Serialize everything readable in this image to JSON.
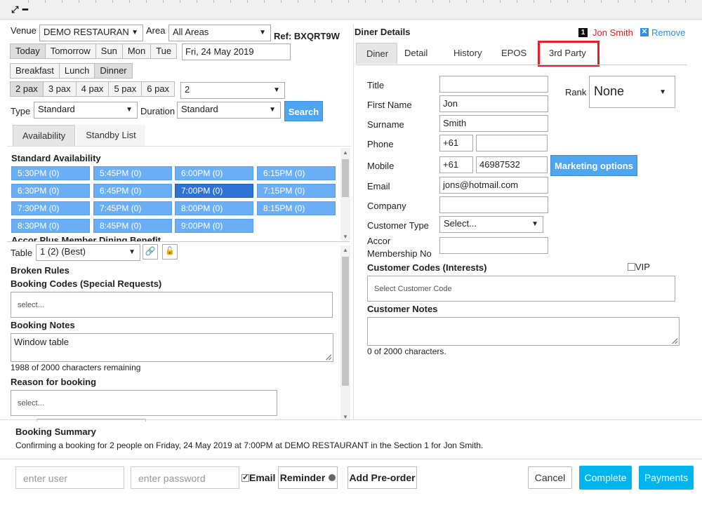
{
  "window": {
    "expand_icon": "⤢",
    "minimize_icon": "━"
  },
  "left": {
    "venue_label": "Venue",
    "venue_value": "DEMO RESTAURAN",
    "area_label": "Area",
    "area_value": "All Areas",
    "ref": "Ref: BXQRT9W",
    "days": [
      "Today",
      "Tomorrow",
      "Sun",
      "Mon",
      "Tue"
    ],
    "date_value": "Fri, 24 May 2019",
    "meals": [
      "Breakfast",
      "Lunch",
      "Dinner"
    ],
    "pax": [
      "2 pax",
      "3 pax",
      "4 pax",
      "5 pax",
      "6 pax"
    ],
    "pax_select": "2",
    "type_label": "Type",
    "type_value": "Standard",
    "duration_label": "Duration",
    "duration_value": "Standard",
    "search_label": "Search",
    "tabs": [
      "Availability",
      "Standby List"
    ],
    "availability_heading": "Standard Availability",
    "slots": [
      "5:30PM (0)",
      "5:45PM (0)",
      "6:00PM (0)",
      "6:15PM (0)",
      "6:30PM (0)",
      "6:45PM (0)",
      "7:00PM (0)",
      "7:15PM (0)",
      "7:30PM (0)",
      "7:45PM (0)",
      "8:00PM (0)",
      "8:15PM (0)",
      "8:30PM (0)",
      "8:45PM (0)",
      "9:00PM (0)"
    ],
    "selected_slot": "7:00PM (0)",
    "cut_heading": "Accor Plus Member Dining Benefit",
    "table_label": "Table",
    "table_value": "1 (2) (Best)",
    "broken_rules": "Broken Rules",
    "booking_codes_label": "Booking Codes (Special Requests)",
    "booking_codes_placeholder": "select...",
    "booking_notes_label": "Booking Notes",
    "booking_notes_value": "Window table",
    "chars_remaining": "1988 of 2000 characters remaining",
    "reason_label": "Reason for booking",
    "reason_placeholder": "select..."
  },
  "right": {
    "heading": "Diner Details",
    "badge": "1",
    "diner_name": "Jon Smith",
    "remove_label": "Remove",
    "tabs": [
      "Diner",
      "Detail",
      "History",
      "EPOS",
      "3rd Party"
    ],
    "highlight_color": "#d9252b",
    "title_label": "Title",
    "title_value": "",
    "first_name_label": "First Name",
    "first_name_value": "Jon",
    "surname_label": "Surname",
    "surname_value": "Smith",
    "phone_label": "Phone",
    "phone_code": "+61",
    "phone_value": "",
    "mobile_label": "Mobile",
    "mobile_code": "+61",
    "mobile_value": "46987532",
    "marketing_label": "Marketing options",
    "email_label": "Email",
    "email_value": "jons@hotmail.com",
    "company_label": "Company",
    "company_value": "",
    "customer_type_label": "Customer Type",
    "customer_type_value": "Select...",
    "accor_label_1": "Accor",
    "accor_label_2": "Membership No",
    "rank_label": "Rank",
    "rank_value": "None",
    "customer_codes_label": "Customer Codes (Interests)",
    "vip_label": "VIP",
    "customer_code_placeholder": "Select Customer Code",
    "customer_notes_label": "Customer Notes",
    "notes_count": "0 of 2000 characters."
  },
  "summary": {
    "heading": "Booking Summary",
    "text": "Confirming a booking for 2 people on Friday, 24 May 2019 at 7:00PM at DEMO RESTAURANT in the Section 1 for Jon Smith."
  },
  "footer": {
    "user_placeholder": "enter user",
    "password_placeholder": "enter password",
    "email_label": "Email",
    "reminder_label": "Reminder",
    "preorder_label": "Add Pre-order",
    "cancel_label": "Cancel",
    "complete_label": "Complete",
    "payments_label": "Payments"
  }
}
